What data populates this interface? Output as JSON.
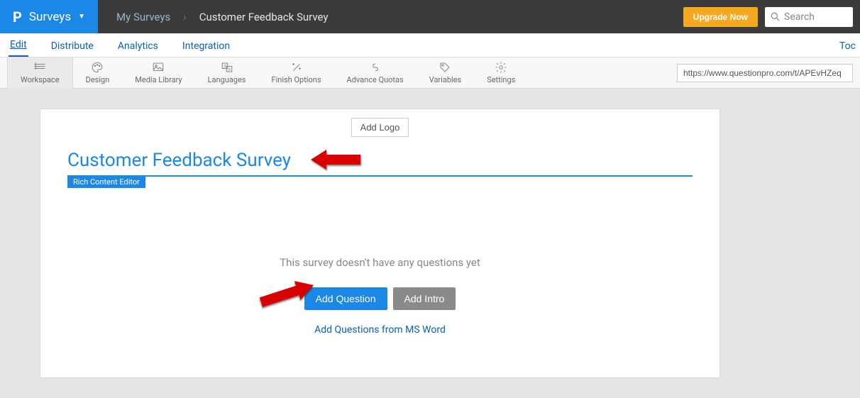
{
  "header": {
    "brand": "Surveys",
    "breadcrumb": {
      "link": "My Surveys",
      "current": "Customer Feedback Survey"
    },
    "upgrade_label": "Upgrade Now",
    "search_placeholder": "Search"
  },
  "tabs": {
    "edit": "Edit",
    "distribute": "Distribute",
    "analytics": "Analytics",
    "integration": "Integration",
    "tools": "Toc"
  },
  "toolbar": {
    "workspace": "Workspace",
    "design": "Design",
    "media": "Media Library",
    "languages": "Languages",
    "finish": "Finish Options",
    "quotas": "Advance Quotas",
    "variables": "Variables",
    "settings": "Settings",
    "url": "https://www.questionpro.com/t/APEvHZeq"
  },
  "survey": {
    "add_logo": "Add Logo",
    "title": "Customer Feedback Survey",
    "editor_label": "Rich Content Editor",
    "empty_text": "This survey doesn't have any questions yet",
    "add_question": "Add Question",
    "add_intro": "Add Intro",
    "word_link": "Add Questions from MS Word"
  }
}
